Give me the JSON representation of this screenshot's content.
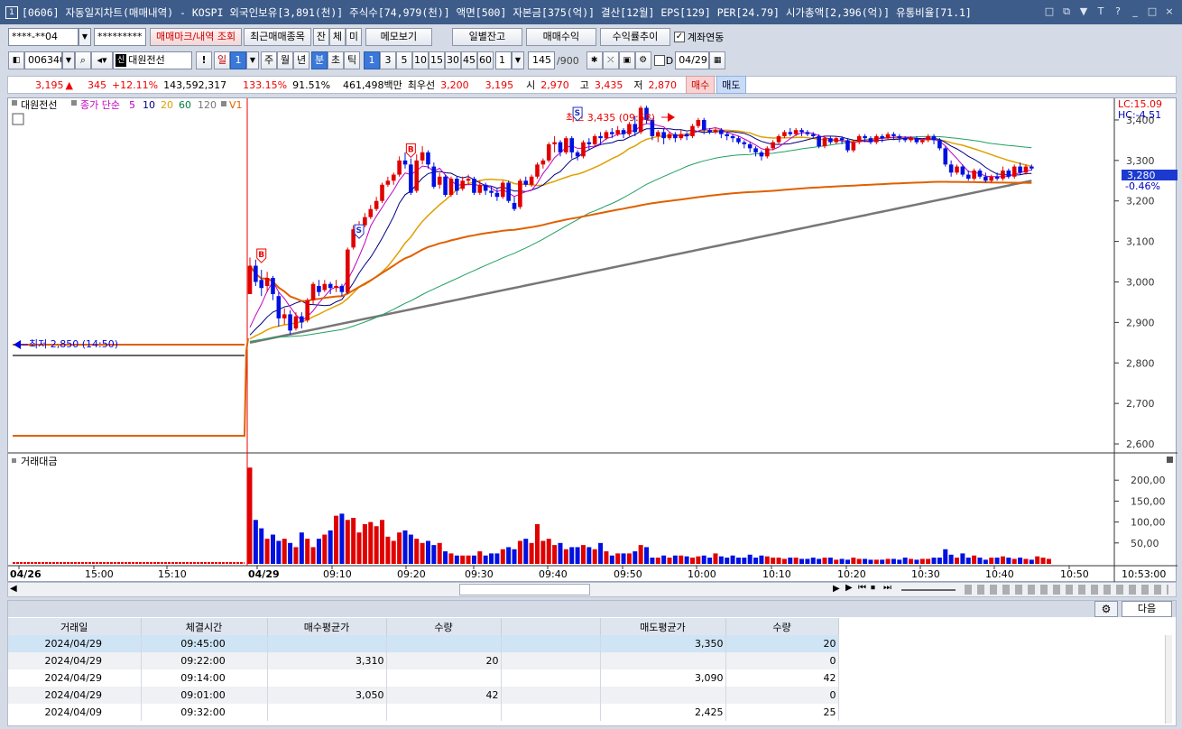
{
  "window": {
    "title": "[0606] 자동일지차트(매매내역) - KOSPI 외국인보유[3,891(천)] 주식수[74,979(천)] 액면[500] 자본금[375(억)] 결산[12월] EPS[129] PER[24.79] 시가총액[2,396(억)] 유통비율[71.1]",
    "app_icon": "1",
    "buttons": [
      "□",
      "⧉",
      "▼",
      "T",
      "?",
      "_",
      "□",
      "×"
    ]
  },
  "toolbar1": {
    "account": "****-**04",
    "password": "*********",
    "buttons": [
      "매매마크/내역 조회",
      "최근매매종목"
    ],
    "small": [
      "잔",
      "체",
      "미"
    ],
    "memo": "메모보기",
    "right_buttons": [
      "일별잔고",
      "매매수익",
      "수익률추이"
    ],
    "link_label": "계좌연동",
    "link_checked": "✓"
  },
  "toolbar2": {
    "code": "006340",
    "name": "대원전선",
    "name_badge": "신",
    "bang": "!",
    "period_day": "일",
    "period_day_n": "1",
    "periods": [
      "주",
      "월",
      "년"
    ],
    "minute": "분",
    "others": [
      "초",
      "틱"
    ],
    "intervals": [
      "1",
      "3",
      "5",
      "10",
      "15",
      "30",
      "45",
      "60"
    ],
    "interval_selected": "1",
    "count": "1",
    "bars": "145",
    "bars_max": "/900",
    "date_chk": "D",
    "date": "04/29"
  },
  "quote": {
    "price": "3,195",
    "arrow": "▲",
    "change": "345",
    "pct": "+12.11%",
    "volume": "143,592,317",
    "r1": "133.15%",
    "r2": "91.51%",
    "amount": "461,498백만",
    "pref_label": "최우선",
    "bid": "3,200",
    "ask": "3,195",
    "open_l": "시",
    "open": "2,970",
    "high_l": "고",
    "high": "3,435",
    "low_l": "저",
    "low": "2,870",
    "buy": "매수",
    "sell": "매도"
  },
  "chart_data": [
    {
      "type": "candlestick",
      "title": "대원전선",
      "legend": {
        "label": "종가 단순",
        "periods": [
          "5",
          "10",
          "20",
          "60",
          "120"
        ],
        "extra": "V1"
      },
      "lc": "LC:15.09",
      "hc": "HC:-4.51",
      "current_label": "3,280",
      "current_pct": "-0.46%",
      "ylim": [
        2580,
        3440
      ],
      "yticks": [
        "3,400",
        "3,300",
        "3,200",
        "3,100",
        "3,000",
        "2,900",
        "2,800",
        "2,700",
        "2,600"
      ],
      "min_label": "최저 2,850 (14:50)",
      "max_label": "최고 3,435 (09:58)",
      "candles": [
        [
          2970,
          3040,
          2980,
          3060
        ],
        [
          3040,
          3000,
          2990,
          3055
        ],
        [
          3005,
          2985,
          2965,
          3030
        ],
        [
          2990,
          3010,
          2975,
          3025
        ],
        [
          3010,
          2970,
          2955,
          3015
        ],
        [
          2965,
          2910,
          2890,
          2975
        ],
        [
          2910,
          2920,
          2895,
          2935
        ],
        [
          2920,
          2880,
          2870,
          2930
        ],
        [
          2885,
          2915,
          2880,
          2925
        ],
        [
          2915,
          2900,
          2885,
          2925
        ],
        [
          2905,
          2955,
          2900,
          2960
        ],
        [
          2955,
          2995,
          2945,
          3000
        ],
        [
          2990,
          2975,
          2965,
          3005
        ],
        [
          2980,
          2995,
          2975,
          3005
        ],
        [
          2995,
          2985,
          2970,
          3000
        ],
        [
          2985,
          2990,
          2975,
          3005
        ],
        [
          2990,
          2975,
          2965,
          2995
        ],
        [
          2975,
          3080,
          2970,
          3085
        ],
        [
          3085,
          3130,
          3080,
          3140
        ],
        [
          3125,
          3140,
          3110,
          3150
        ],
        [
          3140,
          3160,
          3135,
          3170
        ],
        [
          3160,
          3180,
          3155,
          3190
        ],
        [
          3180,
          3200,
          3175,
          3210
        ],
        [
          3200,
          3240,
          3195,
          3245
        ],
        [
          3240,
          3250,
          3235,
          3260
        ],
        [
          3250,
          3265,
          3240,
          3270
        ],
        [
          3265,
          3300,
          3260,
          3310
        ],
        [
          3300,
          3290,
          3280,
          3320
        ],
        [
          3290,
          3220,
          3215,
          3305
        ],
        [
          3225,
          3300,
          3220,
          3315
        ],
        [
          3300,
          3320,
          3290,
          3335
        ],
        [
          3320,
          3290,
          3280,
          3325
        ],
        [
          3285,
          3235,
          3230,
          3295
        ],
        [
          3240,
          3260,
          3230,
          3270
        ],
        [
          3260,
          3215,
          3210,
          3265
        ],
        [
          3215,
          3255,
          3210,
          3260
        ],
        [
          3255,
          3225,
          3215,
          3260
        ],
        [
          3230,
          3250,
          3225,
          3260
        ],
        [
          3250,
          3255,
          3240,
          3265
        ],
        [
          3255,
          3220,
          3215,
          3260
        ],
        [
          3220,
          3240,
          3215,
          3250
        ],
        [
          3240,
          3225,
          3215,
          3245
        ],
        [
          3225,
          3220,
          3210,
          3235
        ],
        [
          3220,
          3210,
          3200,
          3230
        ],
        [
          3210,
          3245,
          3205,
          3250
        ],
        [
          3245,
          3200,
          3195,
          3250
        ],
        [
          3195,
          3180,
          3175,
          3210
        ],
        [
          3185,
          3250,
          3180,
          3255
        ],
        [
          3250,
          3240,
          3235,
          3260
        ],
        [
          3240,
          3260,
          3235,
          3265
        ],
        [
          3260,
          3290,
          3255,
          3295
        ],
        [
          3290,
          3300,
          3280,
          3305
        ],
        [
          3300,
          3340,
          3295,
          3345
        ],
        [
          3340,
          3345,
          3320,
          3360
        ],
        [
          3345,
          3320,
          3310,
          3350
        ],
        [
          3320,
          3355,
          3315,
          3360
        ],
        [
          3355,
          3320,
          3305,
          3360
        ],
        [
          3320,
          3310,
          3300,
          3325
        ],
        [
          3310,
          3345,
          3305,
          3350
        ],
        [
          3345,
          3340,
          3325,
          3355
        ],
        [
          3340,
          3360,
          3335,
          3365
        ],
        [
          3360,
          3355,
          3340,
          3370
        ],
        [
          3355,
          3370,
          3350,
          3375
        ],
        [
          3370,
          3365,
          3355,
          3380
        ],
        [
          3365,
          3375,
          3360,
          3385
        ],
        [
          3375,
          3365,
          3355,
          3380
        ],
        [
          3365,
          3390,
          3360,
          3395
        ],
        [
          3390,
          3370,
          3360,
          3410
        ],
        [
          3370,
          3430,
          3365,
          3435
        ],
        [
          3430,
          3400,
          3390,
          3435
        ],
        [
          3400,
          3360,
          3350,
          3405
        ],
        [
          3360,
          3370,
          3345,
          3375
        ],
        [
          3370,
          3355,
          3340,
          3380
        ],
        [
          3355,
          3365,
          3350,
          3370
        ],
        [
          3365,
          3355,
          3345,
          3370
        ],
        [
          3355,
          3365,
          3350,
          3375
        ],
        [
          3365,
          3360,
          3350,
          3370
        ],
        [
          3360,
          3385,
          3355,
          3390
        ],
        [
          3385,
          3400,
          3380,
          3405
        ],
        [
          3400,
          3375,
          3365,
          3405
        ],
        [
          3375,
          3370,
          3365,
          3380
        ],
        [
          3370,
          3375,
          3365,
          3380
        ],
        [
          3375,
          3365,
          3355,
          3380
        ],
        [
          3365,
          3360,
          3350,
          3370
        ],
        [
          3360,
          3355,
          3345,
          3365
        ],
        [
          3355,
          3345,
          3340,
          3360
        ],
        [
          3345,
          3340,
          3330,
          3350
        ],
        [
          3340,
          3330,
          3320,
          3345
        ],
        [
          3330,
          3320,
          3310,
          3335
        ],
        [
          3320,
          3310,
          3300,
          3325
        ],
        [
          3310,
          3330,
          3305,
          3335
        ],
        [
          3330,
          3345,
          3325,
          3350
        ],
        [
          3345,
          3360,
          3340,
          3365
        ],
        [
          3360,
          3370,
          3355,
          3375
        ],
        [
          3370,
          3365,
          3360,
          3380
        ],
        [
          3365,
          3375,
          3360,
          3380
        ],
        [
          3375,
          3370,
          3360,
          3380
        ],
        [
          3370,
          3365,
          3360,
          3375
        ],
        [
          3365,
          3360,
          3355,
          3370
        ],
        [
          3360,
          3335,
          3330,
          3365
        ],
        [
          3335,
          3355,
          3330,
          3360
        ],
        [
          3355,
          3345,
          3340,
          3360
        ],
        [
          3345,
          3355,
          3340,
          3360
        ],
        [
          3355,
          3350,
          3340,
          3360
        ],
        [
          3350,
          3325,
          3320,
          3355
        ],
        [
          3325,
          3345,
          3320,
          3350
        ],
        [
          3345,
          3360,
          3340,
          3365
        ],
        [
          3360,
          3355,
          3345,
          3365
        ],
        [
          3355,
          3345,
          3340,
          3360
        ],
        [
          3345,
          3360,
          3340,
          3365
        ],
        [
          3360,
          3355,
          3345,
          3365
        ],
        [
          3355,
          3365,
          3350,
          3370
        ],
        [
          3365,
          3360,
          3350,
          3370
        ],
        [
          3360,
          3355,
          3345,
          3365
        ],
        [
          3355,
          3350,
          3345,
          3360
        ],
        [
          3350,
          3355,
          3345,
          3360
        ],
        [
          3355,
          3345,
          3340,
          3360
        ],
        [
          3345,
          3350,
          3340,
          3355
        ],
        [
          3350,
          3360,
          3345,
          3365
        ],
        [
          3360,
          3350,
          3340,
          3365
        ],
        [
          3350,
          3330,
          3325,
          3355
        ],
        [
          3330,
          3290,
          3285,
          3335
        ],
        [
          3290,
          3270,
          3260,
          3300
        ],
        [
          3270,
          3285,
          3265,
          3290
        ],
        [
          3285,
          3265,
          3260,
          3290
        ],
        [
          3265,
          3255,
          3250,
          3275
        ],
        [
          3255,
          3275,
          3250,
          3280
        ],
        [
          3275,
          3260,
          3255,
          3280
        ],
        [
          3260,
          3250,
          3245,
          3270
        ],
        [
          3250,
          3260,
          3245,
          3265
        ],
        [
          3260,
          3255,
          3250,
          3270
        ],
        [
          3255,
          3275,
          3250,
          3285
        ],
        [
          3275,
          3260,
          3255,
          3280
        ],
        [
          3260,
          3285,
          3255,
          3290
        ],
        [
          3285,
          3270,
          3265,
          3295
        ],
        [
          3270,
          3285,
          3265,
          3290
        ],
        [
          3285,
          3280,
          3275,
          3290
        ]
      ],
      "ma": {
        "ma120": [
          [
            2850,
            2820
          ],
          [
            3200,
            3205
          ],
          [
            3600,
            3215
          ]
        ],
        "ma60": [
          [
            2855,
            2850
          ],
          [
            3280,
            3330
          ]
        ]
      },
      "x_labels": [
        "04/26",
        "15:00",
        "15:10",
        "04/29",
        "09:10",
        "09:20",
        "09:30",
        "09:40",
        "09:50",
        "10:00",
        "10:10",
        "10:20",
        "10:30",
        "10:40",
        "10:50"
      ],
      "time_label": "10:53:00"
    },
    {
      "type": "bar",
      "title": "거래대금",
      "yticks": [
        "200,00",
        "150,00",
        "100,00",
        "50,00"
      ],
      "values": [
        230,
        105,
        85,
        60,
        70,
        55,
        60,
        50,
        40,
        75,
        60,
        40,
        60,
        70,
        80,
        115,
        120,
        105,
        110,
        75,
        95,
        100,
        90,
        105,
        65,
        55,
        75,
        80,
        70,
        60,
        50,
        55,
        45,
        50,
        30,
        25,
        20,
        20,
        20,
        20,
        30,
        20,
        25,
        25,
        35,
        40,
        35,
        55,
        60,
        50,
        95,
        55,
        60,
        45,
        50,
        35,
        40,
        40,
        45,
        40,
        35,
        50,
        30,
        20,
        25,
        25,
        25,
        30,
        45,
        40,
        15,
        15,
        20,
        15,
        20,
        20,
        18,
        15,
        18,
        20,
        15,
        25,
        18,
        15,
        20,
        15,
        15,
        22,
        15,
        20,
        18,
        15,
        15,
        12,
        15,
        15,
        12,
        12,
        15,
        12,
        15,
        15,
        10,
        12,
        10,
        15,
        12,
        12,
        10,
        10,
        10,
        12,
        12,
        10,
        15,
        12,
        10,
        12,
        12,
        15,
        15,
        35,
        22,
        15,
        25,
        15,
        20,
        15,
        10,
        15,
        15,
        18,
        15,
        12,
        15,
        12,
        10,
        18,
        15,
        12
      ]
    }
  ],
  "scroll": {
    "left": "◀",
    "right": "▶",
    "ctrls": [
      "▶",
      "⏮",
      "⏹",
      "⏭"
    ]
  },
  "bottom": {
    "next": "다음",
    "gear": "⚙",
    "headers": [
      "거래일",
      "체결시간",
      "매수평균가",
      "수량",
      "",
      "매도평균가",
      "수량"
    ],
    "rows": [
      [
        "2024/04/29",
        "09:45:00",
        "",
        "",
        "",
        "3,350",
        "20"
      ],
      [
        "2024/04/29",
        "09:22:00",
        "3,310",
        "20",
        "",
        "",
        "0"
      ],
      [
        "2024/04/29",
        "09:14:00",
        "",
        "",
        "",
        "3,090",
        "42"
      ],
      [
        "2024/04/29",
        "09:01:00",
        "3,050",
        "42",
        "",
        "",
        "0"
      ],
      [
        "2024/04/09",
        "09:32:00",
        "",
        "",
        "",
        "2,425",
        "25"
      ]
    ]
  }
}
